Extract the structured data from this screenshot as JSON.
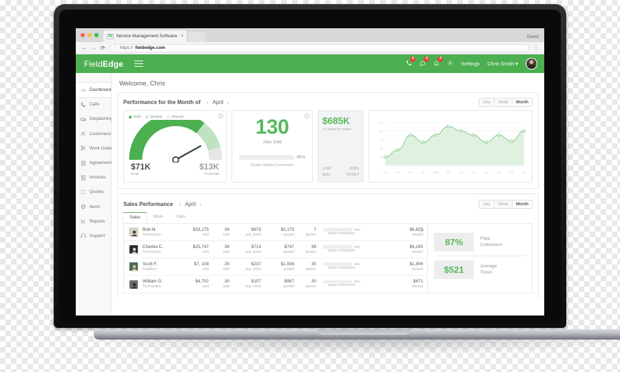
{
  "browser": {
    "tab_title": "Service Management Software",
    "tab_favicon": "FE",
    "close_glyph": "×",
    "guest_label": "Guest",
    "back_glyph": "←",
    "forward_glyph": "→",
    "reload_glyph": "⟳",
    "lock_glyph": "ⓘ",
    "url_prefix": "https://",
    "url_domain": "fieldedge.com",
    "menu_glyph": "⋮"
  },
  "topbar": {
    "brand_light": "Field",
    "brand_bold": "Edge",
    "icons": [
      {
        "name": "phone-icon",
        "glyph": "✆",
        "badge": "4"
      },
      {
        "name": "chat-icon",
        "glyph": "▭",
        "badge": "4"
      },
      {
        "name": "bell-icon",
        "glyph": "🔔",
        "badge": "2"
      }
    ],
    "settings_glyph": "⚙",
    "settings_label": "Settings",
    "user_label": "Chris Smith",
    "user_caret": "▾"
  },
  "sidebar": {
    "items": [
      {
        "label": "Dashboard",
        "icon": "gauge-icon",
        "glyph": "◠",
        "active": true
      },
      {
        "label": "Calls",
        "icon": "phone-icon",
        "glyph": "✆",
        "active": false
      },
      {
        "label": "Dispatching",
        "icon": "truck-icon",
        "glyph": "▭",
        "active": false
      },
      {
        "label": "Customers",
        "icon": "people-icon",
        "glyph": "♟",
        "active": false
      },
      {
        "label": "Work Orders",
        "icon": "tools-icon",
        "glyph": "✂",
        "active": false
      },
      {
        "label": "Agreements",
        "icon": "document-icon",
        "glyph": "▤",
        "active": false
      },
      {
        "label": "Invoices",
        "icon": "invoice-icon",
        "glyph": "▥",
        "active": false
      },
      {
        "label": "Quotes",
        "icon": "quote-icon",
        "glyph": "▣",
        "active": false
      },
      {
        "label": "Items",
        "icon": "box-icon",
        "glyph": "◌",
        "active": false
      },
      {
        "label": "Reports",
        "icon": "chart-icon",
        "glyph": "◿",
        "active": false
      },
      {
        "label": "Support",
        "icon": "headset-icon",
        "glyph": "◡",
        "active": false
      }
    ]
  },
  "main": {
    "welcome": "Welcome, Chris",
    "performance": {
      "title": "Performance for the Month of",
      "month": "April",
      "prev_glyph": "‹",
      "next_glyph": "›",
      "range_options": [
        "Day",
        "Week",
        "Month"
      ],
      "range_selected": "Month",
      "info_glyph": "i"
    },
    "gauge_card": {
      "legend": [
        {
          "label": "Sold",
          "color": "#4caf50"
        },
        {
          "label": "Quoted",
          "color": "#bfe3c0"
        },
        {
          "label": "Missed",
          "color": "#e4e6e7"
        }
      ],
      "sold_value": "$71K",
      "sold_label": "Sold",
      "potential_value": "$13K",
      "potential_label": "Potential"
    },
    "jobs_card": {
      "number": "130",
      "label": "Jobs Sold",
      "progress_pct": "85%",
      "progress_value": 85,
      "progress_caption": "Quote Dollars Converted"
    },
    "revenue_card": {
      "amount": "$685K",
      "caption": "12 MONTH JOBS",
      "rows": [
        {
          "value": "1,667",
          "label": "JOBS"
        },
        {
          "value": "$411",
          "label": "TICKET"
        }
      ]
    },
    "sales": {
      "title": "Sales Performance",
      "month": "April",
      "prev_glyph": "‹",
      "next_glyph": "›",
      "range_options": [
        "Day",
        "Week",
        "Month"
      ],
      "range_selected": "Month",
      "tabs": [
        {
          "label": "Sales",
          "active": true
        },
        {
          "label": "Work",
          "active": false
        },
        {
          "label": "Calls",
          "active": false
        }
      ],
      "column_captions": {
        "role": "",
        "sold_dollars": "sold",
        "sold_count": "sold",
        "avg_ticket": "avg. ticket",
        "quoted": "quoted",
        "quotes": "quotes",
        "conversion": "quote conversion",
        "missed": "missed"
      },
      "rows": [
        {
          "name": "Bob M.",
          "role": "Technicians",
          "sold_dollars": "$33,175",
          "sold_count": "34",
          "avg_ticket": "$975",
          "quoted": "$3,175",
          "quotes": "7",
          "conversion_pct": "98%",
          "conversion_value": 78,
          "missed": "$6,825",
          "avatar_bg": "#d6cfc4",
          "avatar_fg": "#4b3f33"
        },
        {
          "name": "Charles C.",
          "role": "Technicians",
          "sold_dollars": "$25,747",
          "sold_count": "36",
          "avg_ticket": "$715",
          "quoted": "$747",
          "quotes": "36",
          "conversion_pct": "98%",
          "conversion_value": 78,
          "missed": "$4,290",
          "avatar_bg": "#2e2e2e",
          "avatar_fg": "#cfcfcf"
        },
        {
          "name": "Scott F.",
          "role": "Installers",
          "sold_dollars": "$7, 108",
          "sold_count": "30",
          "avg_ticket": "$237",
          "quoted": "$1,008",
          "quotes": "30",
          "conversion_pct": "98%",
          "conversion_value": 78,
          "missed": "$1,806",
          "avatar_bg": "#4b6b52",
          "avatar_fg": "#d8c0a8"
        },
        {
          "name": "William G.",
          "role": "Technicians",
          "sold_dollars": "$4,702",
          "sold_count": "30",
          "avg_ticket": "$157",
          "quoted": "$987",
          "quotes": "30",
          "conversion_pct": "98%",
          "conversion_value": 78,
          "missed": "$471",
          "avatar_bg": "#6b6b6b",
          "avatar_fg": "#2b2b2b"
        }
      ],
      "info_glyph": "i"
    },
    "side_stats": [
      {
        "value": "87%",
        "label": "Field\nCollections"
      },
      {
        "value": "$521",
        "label": "Average\nTicket"
      }
    ]
  },
  "chart_data": {
    "type": "area",
    "title": "",
    "xlabel": "",
    "ylabel": "",
    "categories": [
      "Jan",
      "Feb",
      "Mar",
      "Apr",
      "May",
      "Jun",
      "Jul",
      "Aug",
      "Sep",
      "Oct",
      "Nov",
      "Dec"
    ],
    "values": [
      25,
      45,
      88,
      67,
      88,
      113,
      100,
      88,
      67,
      88,
      70,
      100
    ],
    "ylim": [
      0,
      135
    ],
    "yticks": [
      25,
      50,
      75,
      100,
      125
    ],
    "grid": true,
    "legend": "none",
    "line_color": "#7cc47f",
    "fill_color": "#d9eeda"
  }
}
